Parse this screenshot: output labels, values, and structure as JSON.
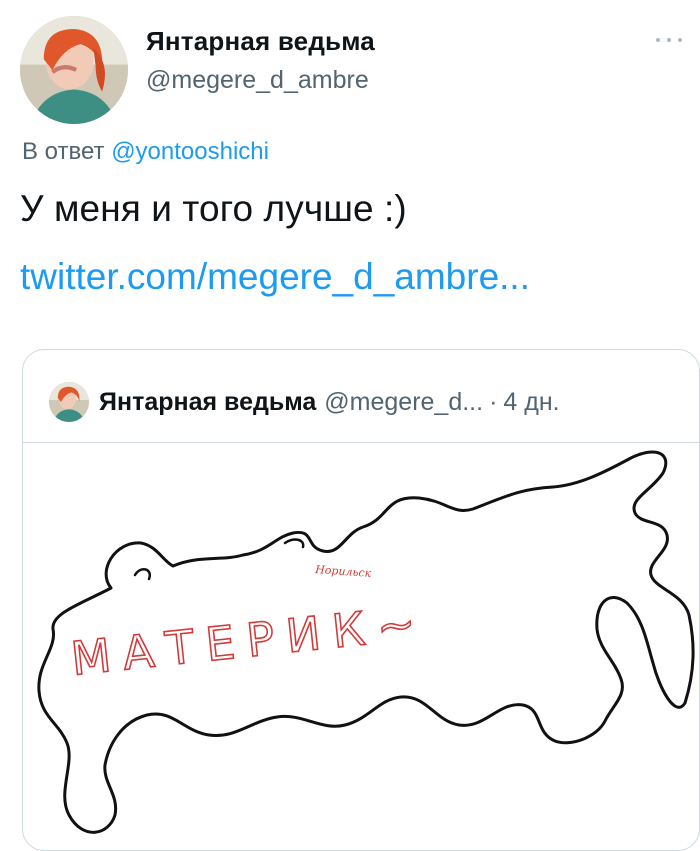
{
  "author": {
    "display_name": "Янтарная ведьма",
    "handle": "@megere_d_ambre"
  },
  "reply": {
    "prefix": "В ответ",
    "to_handle": "@yontooshichi"
  },
  "tweet": {
    "text": "У меня и того лучше :)",
    "link": "twitter.com/megere_d_ambre..."
  },
  "quote": {
    "display_name": "Янтарная ведьма",
    "handle": "@megere_d...",
    "separator": "·",
    "time": "4 дн.",
    "image": {
      "small_label": "Норильск",
      "big_label": "МАТЕРИК~",
      "line_color": "#111111",
      "label_color": "#d33a3a"
    }
  },
  "icons": {
    "more": "more-horizontal-icon"
  }
}
